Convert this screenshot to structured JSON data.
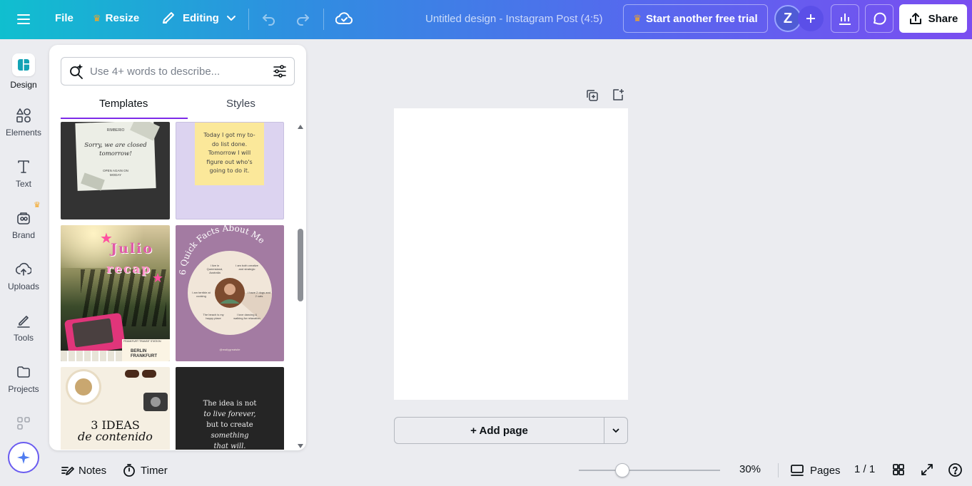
{
  "topbar": {
    "file_label": "File",
    "resize_label": "Resize",
    "editing_label": "Editing",
    "doc_title": "Untitled design - Instagram Post (4:5)",
    "trial_label": "Start another free trial",
    "avatar_letter": "Z",
    "share_label": "Share"
  },
  "rail": {
    "items": [
      {
        "label": "Design",
        "icon": "design-icon"
      },
      {
        "label": "Elements",
        "icon": "elements-icon"
      },
      {
        "label": "Text",
        "icon": "text-icon"
      },
      {
        "label": "Brand",
        "icon": "brand-icon"
      },
      {
        "label": "Uploads",
        "icon": "uploads-icon"
      },
      {
        "label": "Tools",
        "icon": "tools-icon"
      },
      {
        "label": "Projects",
        "icon": "projects-icon"
      }
    ]
  },
  "panel": {
    "search_placeholder": "Use 4+ words to describe...",
    "tabs": [
      "Templates",
      "Styles"
    ],
    "templates": [
      {
        "lines": [
          "RIMBERIO",
          "Sorry, we are closed",
          "tomorrow!",
          "OPEN AGAIN ON",
          "MODAY"
        ]
      },
      {
        "lines": [
          "Today I got my to-",
          "do list done.",
          "Tomorrow I will",
          "figure out who's",
          "going to do it."
        ]
      },
      {
        "lines": [
          "Julio",
          "recap",
          "FRANKFURT TRANSIT STATION",
          "BERLIN",
          "FRANKFURT"
        ]
      },
      {
        "lines": [
          "6 Quick Facts About Me",
          "I live in Queensland, Australia",
          "I am both creative and strategic",
          "I am terrible at cooking",
          "I have 2 dogs and 2 cats",
          "The beach is my happy place",
          "I love dancing & walking for relaxation",
          "@reallygreatsite"
        ]
      },
      {
        "lines": [
          "3 IDEAS",
          "de contenido"
        ]
      },
      {
        "lines": [
          "The idea is not",
          "to live forever,",
          "but to create",
          "something",
          "that will."
        ]
      }
    ]
  },
  "canvas": {
    "add_page_label": "+ Add page"
  },
  "bottombar": {
    "notes_label": "Notes",
    "timer_label": "Timer",
    "zoom_label": "30%",
    "zoom_value": 0.3,
    "pages_label": "Pages",
    "page_count": "1 / 1"
  },
  "colors": {
    "accent": "#7d2ae8",
    "crown": "#f5a623"
  }
}
